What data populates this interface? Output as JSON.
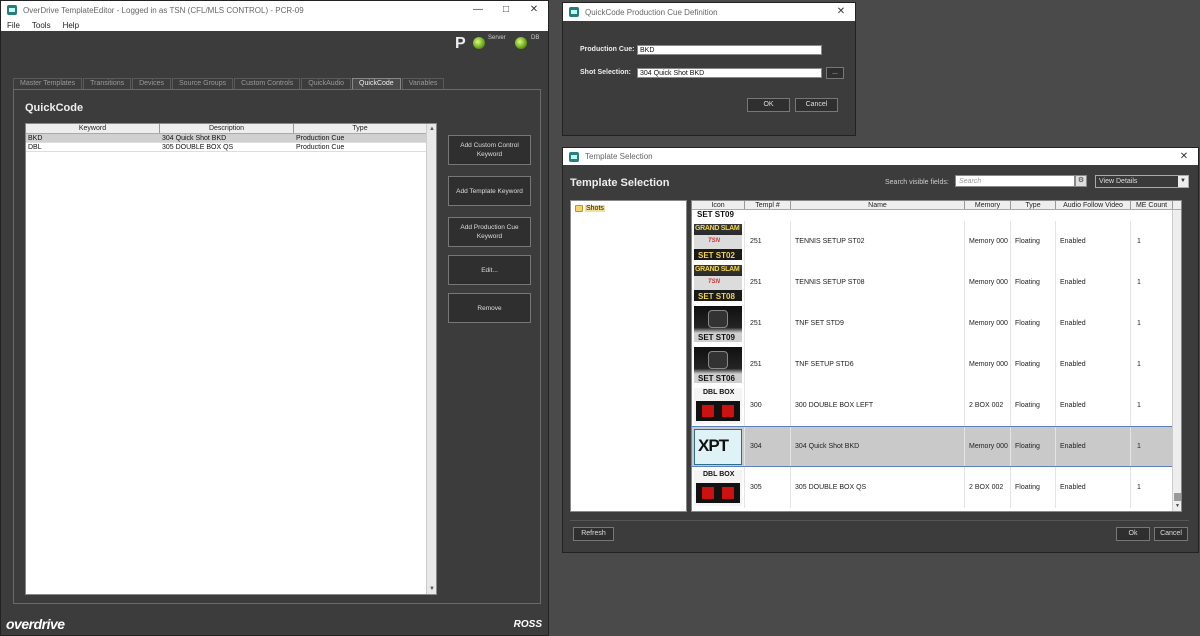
{
  "main_window": {
    "title": "OverDrive TemplateEditor - Logged in as TSN (CFL/MLS CONTROL) - PCR-09",
    "menu": [
      "File",
      "Tools",
      "Help"
    ],
    "status": {
      "p_label": "P",
      "server_label": "Server",
      "db_label": "DB"
    },
    "tabs": [
      {
        "label": "Master Templates",
        "active": false
      },
      {
        "label": "Transitions",
        "active": false
      },
      {
        "label": "Devices",
        "active": false
      },
      {
        "label": "Source Groups",
        "active": false
      },
      {
        "label": "Custom Controls",
        "active": false
      },
      {
        "label": "QuickAudio",
        "active": false
      },
      {
        "label": "QuickCode",
        "active": true
      },
      {
        "label": "Variables",
        "active": false
      }
    ],
    "panel_title": "QuickCode",
    "table": {
      "columns": [
        "Keyword",
        "Description",
        "Type"
      ],
      "rows": [
        {
          "keyword": "BKD",
          "description": "304 Quick Shot BKD",
          "type": "Production Cue",
          "selected": true
        },
        {
          "keyword": "DBL",
          "description": "305 DOUBLE BOX QS",
          "type": "Production Cue",
          "selected": false
        }
      ]
    },
    "buttons": {
      "add_custom_control": "Add Custom Control Keyword",
      "add_template": "Add Template Keyword",
      "add_production_cue": "Add Production Cue Keyword",
      "edit": "Edit...",
      "remove": "Remove"
    },
    "brand": {
      "logo": "overdrive",
      "vendor": "ROSS"
    }
  },
  "cue_dialog": {
    "title": "QuickCode Production Cue Definition",
    "production_cue_label": "Production Cue:",
    "production_cue_value": "BKD",
    "shot_selection_label": "Shot Selection:",
    "shot_selection_value": "304 Quick Shot BKD",
    "browse_label": "...",
    "ok_label": "OK",
    "cancel_label": "Cancel"
  },
  "template_selection": {
    "title": "Template Selection",
    "heading": "Template Selection",
    "search_label": "Search visible fields:",
    "search_placeholder": "Search",
    "view_mode": "View Details",
    "tree": [
      {
        "label": "Shots"
      }
    ],
    "columns": [
      "Icon",
      "Templ #",
      "Name",
      "Memory",
      "Type",
      "Audio Follow Video",
      "ME Count"
    ],
    "cut_row_label": "SET ST09",
    "rows": [
      {
        "thumb": "grand-slam",
        "thumb_top": "GRAND SLAM",
        "thumb_mid": "TSN",
        "thumb_bottom": "SET ST02",
        "templ": "251",
        "name": "TENNIS SETUP ST02",
        "memory": "Memory 000",
        "type": "Floating",
        "afv": "Enabled",
        "me_count": "1",
        "selected": false
      },
      {
        "thumb": "grand-slam",
        "thumb_top": "GRAND SLAM",
        "thumb_mid": "TSN",
        "thumb_bottom": "SET ST08",
        "templ": "251",
        "name": "TENNIS SETUP ST08",
        "memory": "Memory 000",
        "type": "Floating",
        "afv": "Enabled",
        "me_count": "1",
        "selected": false
      },
      {
        "thumb": "tnf",
        "thumb_bottom": "SET ST09",
        "templ": "251",
        "name": "TNF SET STD9",
        "memory": "Memory 000",
        "type": "Floating",
        "afv": "Enabled",
        "me_count": "1",
        "selected": false
      },
      {
        "thumb": "tnf",
        "thumb_bottom": "SET ST06",
        "templ": "251",
        "name": "TNF SETUP STD6",
        "memory": "Memory 000",
        "type": "Floating",
        "afv": "Enabled",
        "me_count": "1",
        "selected": false
      },
      {
        "thumb": "dbl-box",
        "thumb_top": "DBL BOX",
        "templ": "300",
        "name": "300 DOUBLE BOX  LEFT",
        "memory": "2 BOX 002",
        "type": "Floating",
        "afv": "Enabled",
        "me_count": "1",
        "selected": false
      },
      {
        "thumb": "xpt",
        "thumb_top": "XPT",
        "templ": "304",
        "name": "304 Quick Shot BKD",
        "memory": "Memory 000",
        "type": "Floating",
        "afv": "Enabled",
        "me_count": "1",
        "selected": true
      },
      {
        "thumb": "dbl-box",
        "thumb_top": "DBL BOX",
        "templ": "305",
        "name": "305 DOUBLE BOX QS",
        "memory": "2 BOX 002",
        "type": "Floating",
        "afv": "Enabled",
        "me_count": "1",
        "selected": false
      }
    ],
    "refresh_label": "Refresh",
    "ok_label": "Ok",
    "cancel_label": "Cancel"
  },
  "colors": {
    "accent_selection": "#5b7fbf",
    "app_bg": "#3c3c3c",
    "led_green": "#6aa21a"
  }
}
